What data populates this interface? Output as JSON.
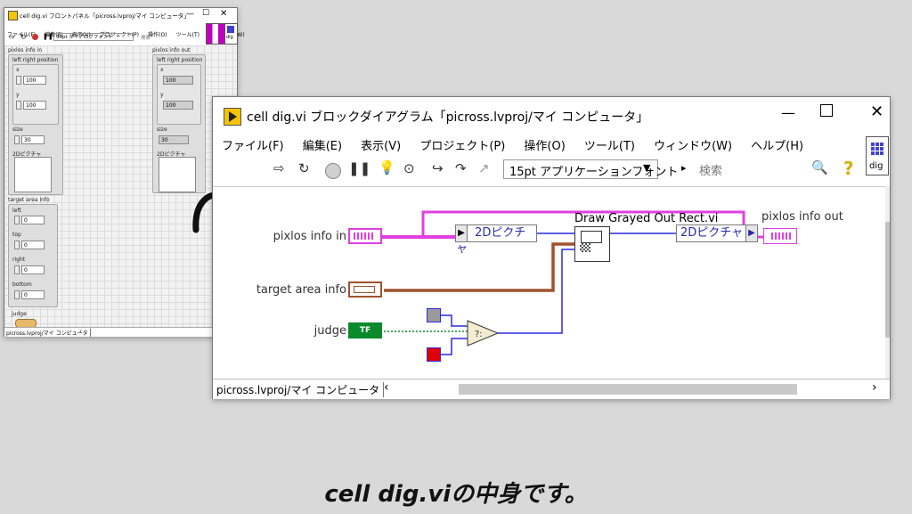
{
  "front_panel": {
    "title": "cell dig.vi フロントパネル「picross.lvproj/マイ コンピュータ」",
    "menu": [
      "ファイル(F)",
      "編集(E)",
      "表示(V)",
      "プロジェクト(P)",
      "操作(O)",
      "ツール(T)",
      "ウィンドウ(W)"
    ],
    "font_select": "36pt ダイアログフォント",
    "search_placeholder": "検索",
    "icon_label": "dig",
    "pixlos_in": {
      "label": "pixlos info in",
      "cluster_label": "left right position",
      "x_label": "x",
      "x_value": "100",
      "y_label": "y",
      "y_value": "100",
      "size_label": "size",
      "size_value": "30",
      "picture_label": "2Dピクチャ"
    },
    "pixlos_out": {
      "label": "pixlos info out",
      "cluster_label": "left right position",
      "x_label": "x",
      "x_value": "100",
      "y_label": "y",
      "y_value": "100",
      "size_label": "size",
      "size_value": "30",
      "picture_label": "2Dピクチャ"
    },
    "target_area": {
      "label": "target area info",
      "left_label": "left",
      "left_value": "0",
      "top_label": "top",
      "top_value": "0",
      "right_label": "right",
      "right_value": "0",
      "bottom_label": "bottom",
      "bottom_value": "0"
    },
    "judge_label": "judge",
    "status": "picross.lvproj/マイ コンピュータ"
  },
  "block_diagram": {
    "title": "cell dig.vi ブロックダイアグラム「picross.lvproj/マイ コンピュータ」",
    "menu": [
      "ファイル(F)",
      "編集(E)",
      "表示(V)",
      "プロジェクト(P)",
      "操作(O)",
      "ツール(T)",
      "ウィンドウ(W)",
      "ヘルプ(H)"
    ],
    "font_select": "15pt アプリケーションフォント",
    "search_placeholder": "検索",
    "icon_label": "dig",
    "labels": {
      "pixlos_in": "pixlos info in",
      "target_area": "target area info",
      "judge": "judge",
      "pixlos_out": "pixlos info out",
      "subvi": "Draw Grayed Out Rect.vi",
      "unbundle": "2Dピクチャ",
      "bundle": "2Dピクチャ",
      "tf": "TF"
    },
    "status": "picross.lvproj/マイ コンピュータ"
  },
  "caption": "cell dig.viの中身です。",
  "colors": {
    "cluster_wire": "#e040e0",
    "picture_wire": "#2a2ae0",
    "target_wire": "#a0522d",
    "bool_wire": "#0a8a2a",
    "gray_const": "#9a9a9a",
    "red_const": "#e00000"
  }
}
